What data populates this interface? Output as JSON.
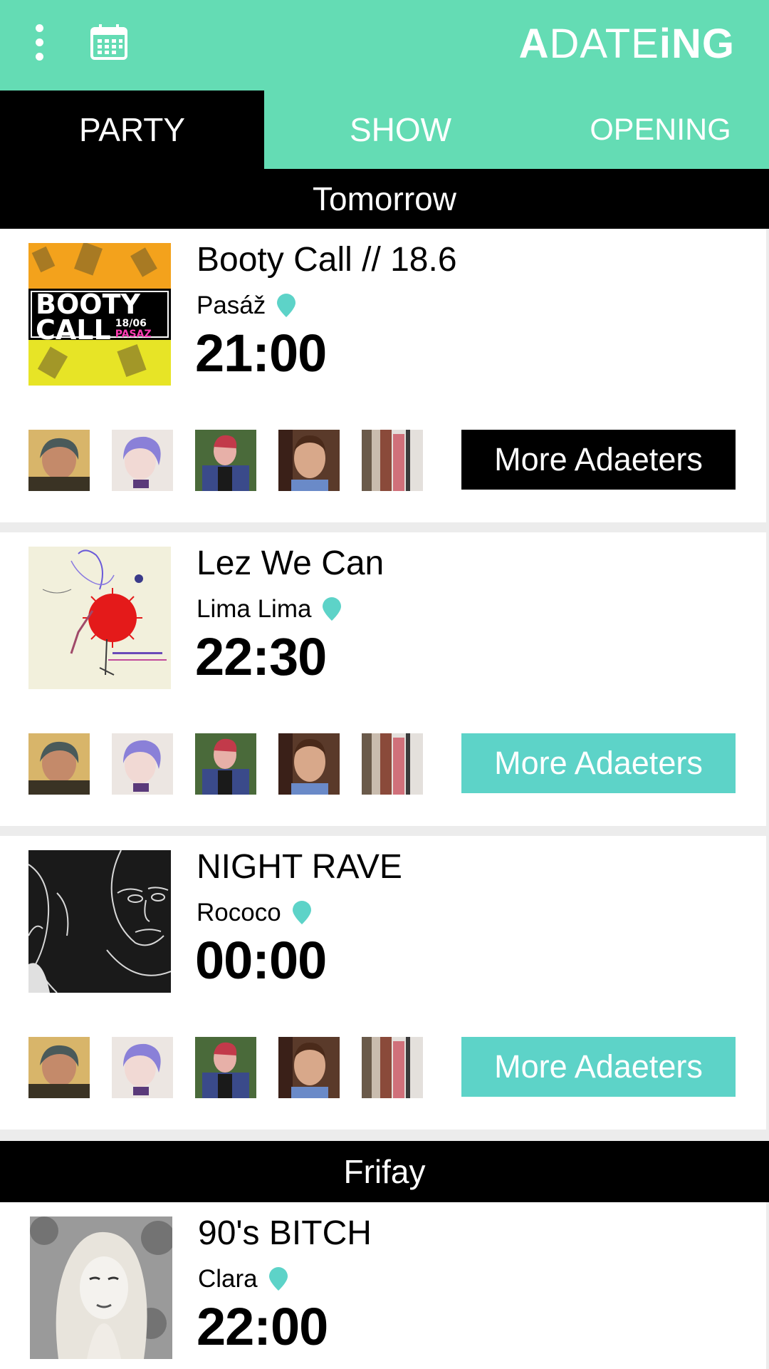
{
  "app": {
    "logo_a": "A",
    "logo_date": "DATE",
    "logo_ing": "iNG"
  },
  "header": {
    "menu_icon": "more-vertical-icon",
    "calendar_icon": "calendar-icon"
  },
  "tabs": [
    {
      "label": "PARTY",
      "active": true
    },
    {
      "label": "SHOW",
      "active": false
    },
    {
      "label": "OPENING",
      "active": false
    }
  ],
  "days": [
    {
      "label": "Tomorrow"
    },
    {
      "label": "Frifay"
    }
  ],
  "events": [
    {
      "title": "Booty Call // 18.6",
      "venue": "Pasáž",
      "time": "21:00",
      "more_label": "More Adaeters",
      "more_style": "dark",
      "poster_text_1": "BOOTY",
      "poster_text_2": "CALL",
      "poster_text_3": "18/06",
      "poster_text_4": "PASAZ"
    },
    {
      "title": "Lez We Can",
      "venue": "Lima Lima",
      "time": "22:30",
      "more_label": "More Adaeters",
      "more_style": "teal"
    },
    {
      "title": "NIGHT RAVE",
      "venue": "Rococo",
      "time": "00:00",
      "more_label": "More Adaeters",
      "more_style": "teal"
    },
    {
      "title": "90's BITCH",
      "venue": "Clara",
      "time": "22:00"
    }
  ],
  "colors": {
    "accent": "#64dcb4",
    "teal_button": "#5dd3c8",
    "pin": "#5dd3c8",
    "black": "#000000"
  }
}
